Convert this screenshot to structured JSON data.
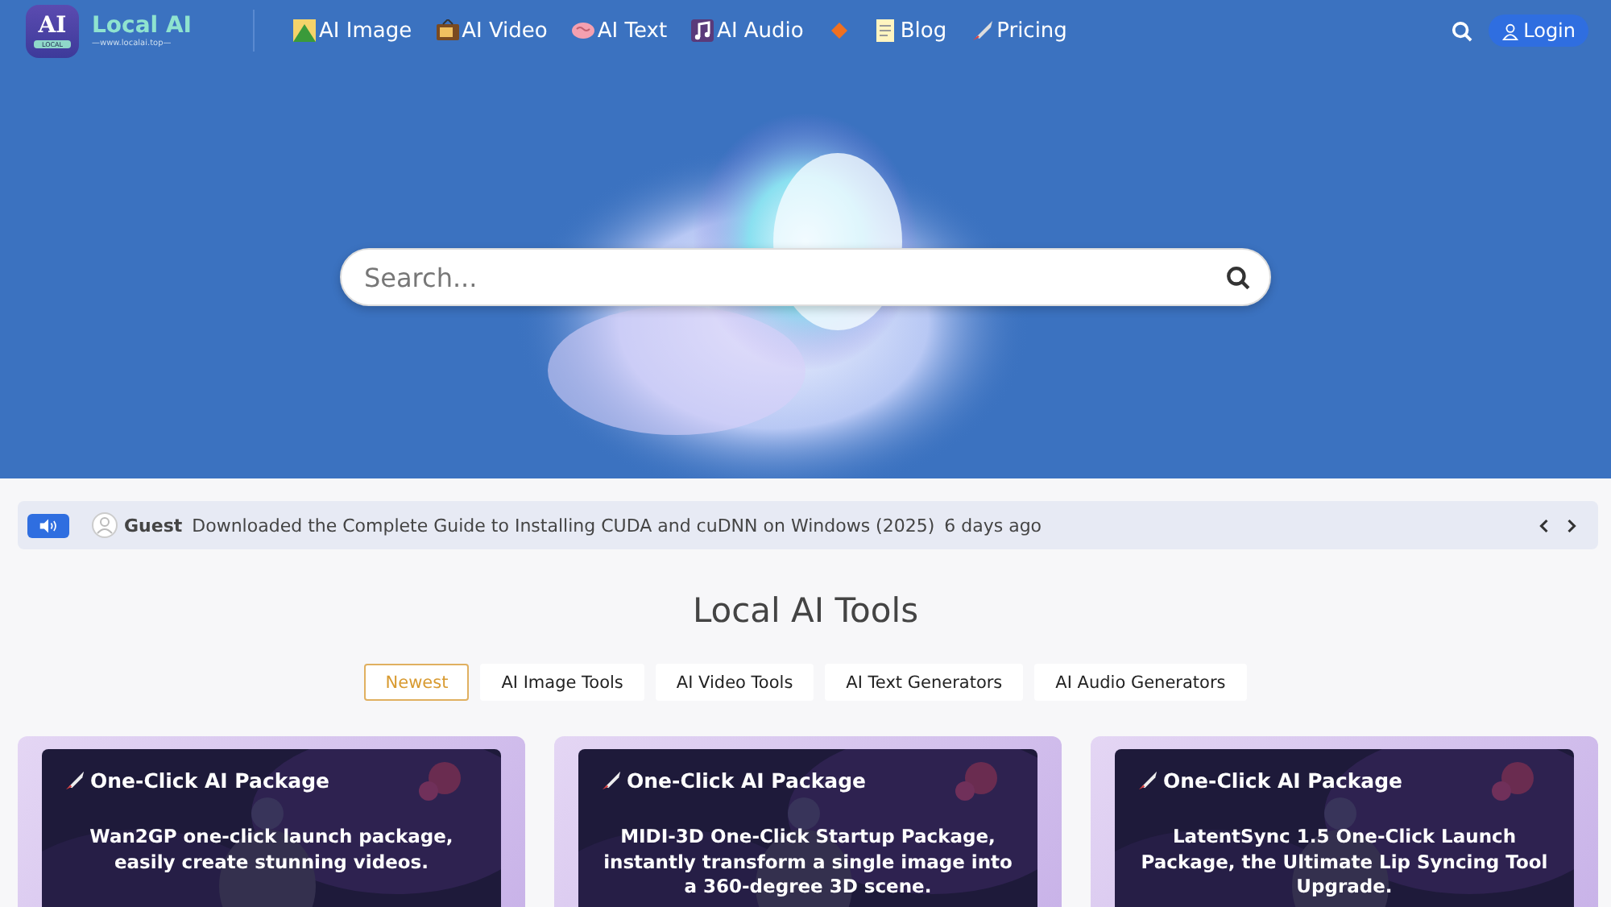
{
  "header": {
    "logo": {
      "letters": "AI",
      "tag": "LOCAL",
      "name": "Local AI",
      "url": "—www.localai.top—"
    },
    "nav": [
      {
        "kind": "link",
        "label": "AI Image"
      },
      {
        "kind": "link",
        "label": "AI Video"
      },
      {
        "kind": "link",
        "label": "AI Text"
      },
      {
        "kind": "link",
        "label": "AI Audio"
      },
      {
        "kind": "icon"
      },
      {
        "kind": "link",
        "label": "Blog"
      },
      {
        "kind": "link",
        "label": "Pricing"
      }
    ],
    "login": "Login"
  },
  "hero": {
    "search": {
      "placeholder": "Search..."
    }
  },
  "notice": {
    "user": "Guest",
    "message": "Downloaded the Complete Guide to Installing CUDA and cuDNN on Windows (2025)",
    "time": "6 days ago"
  },
  "section": {
    "title": "Local AI Tools",
    "tabs": [
      {
        "label": "Newest",
        "selected": true
      },
      {
        "label": "AI Image Tools",
        "selected": false
      },
      {
        "label": "AI Video Tools",
        "selected": false
      },
      {
        "label": "AI Text Generators",
        "selected": false
      },
      {
        "label": "AI Audio Generators",
        "selected": false
      }
    ],
    "cards": [
      {
        "badge": "One-Click AI Package",
        "text": "Wan2GP one-click launch package, easily create stunning videos."
      },
      {
        "badge": "One-Click AI Package",
        "text": "MIDI-3D One-Click Startup Package, instantly transform a single image into a 360-degree 3D scene."
      },
      {
        "badge": "One-Click AI Package",
        "text": "LatentSync 1.5 One-Click Launch Package, the Ultimate Lip Syncing Tool Upgrade."
      }
    ]
  }
}
